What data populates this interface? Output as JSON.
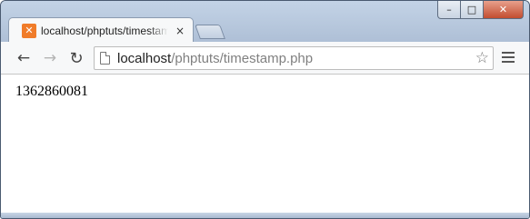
{
  "tab": {
    "title": "localhost/phptuts/timestamp.php",
    "close_glyph": "×",
    "favicon": "xampp-icon"
  },
  "window_controls": {
    "minimize": "–",
    "maximize": "□",
    "close": "✕"
  },
  "toolbar": {
    "back_glyph": "←",
    "forward_glyph": "→",
    "reload_glyph": "↻",
    "star_glyph": "☆"
  },
  "address": {
    "host": "localhost",
    "path": "/phptuts/timestamp.php"
  },
  "page": {
    "body_text": "1362860081"
  },
  "colors": {
    "favicon": "#f07c2a",
    "frame": "#b9c9dd",
    "url_path": "#808080"
  }
}
